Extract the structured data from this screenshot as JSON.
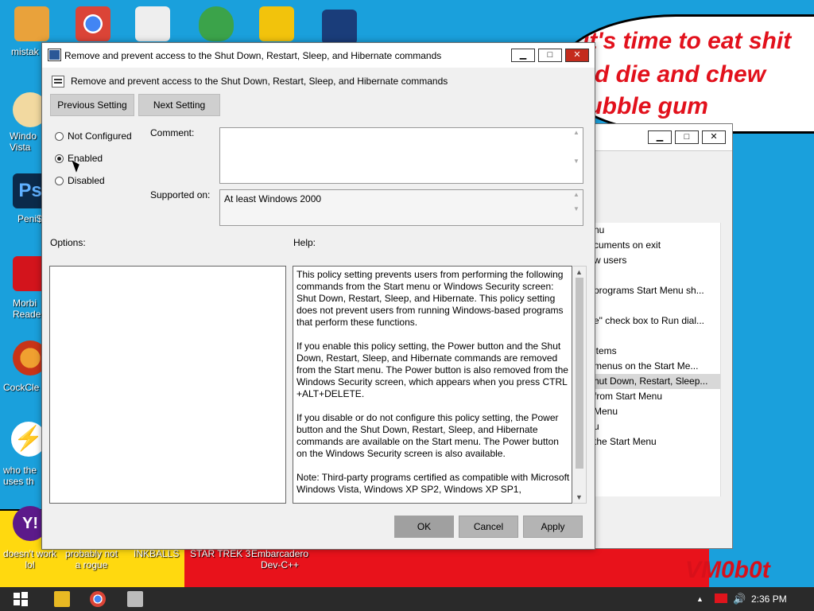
{
  "desktop": {
    "bubble_lines": [
      "it's time to eat shit",
      "and die and chew",
      "bubble gum"
    ],
    "signature": "VM0b0t",
    "icons_left": [
      "mistak",
      "Windo\nVista",
      "Peni$",
      "Morbi\nReade",
      "CockCle",
      "who the\nuses th",
      "doesn't work\nlol"
    ],
    "icons_bottom": [
      "probably not\na rogue",
      "INKBALLS",
      "STAR TREK 3",
      "Embarcadero\nDev-C++"
    ]
  },
  "back_window": {
    "items": [
      "nu",
      "cuments on exit",
      "w users",
      "",
      "programs Start Menu sh...",
      "",
      "e\" check box to Run dial...",
      "",
      "items",
      "menus on the Start Me...",
      "hut Down, Restart, Sleep...",
      "from Start Menu",
      "Menu",
      "u",
      "the Start Menu"
    ]
  },
  "dialog": {
    "title": "Remove and prevent access to the Shut Down, Restart, Sleep, and Hibernate commands",
    "header": "Remove and prevent access to the Shut Down, Restart, Sleep, and Hibernate commands",
    "prev_label": "Previous Setting",
    "next_label": "Next Setting",
    "radio_not_configured": "Not Configured",
    "radio_enabled": "Enabled",
    "radio_disabled": "Disabled",
    "selected": "Enabled",
    "comment_label": "Comment:",
    "supported_label": "Supported on:",
    "supported_value": "At least Windows 2000",
    "options_label": "Options:",
    "help_label": "Help:",
    "help_paragraphs": [
      "This policy setting prevents users from performing the following commands from the Start menu or Windows Security screen: Shut Down, Restart, Sleep, and Hibernate. This policy setting does not prevent users from running Windows-based programs that perform these functions.",
      "If you enable this policy setting, the Power button and the Shut Down, Restart, Sleep, and Hibernate commands are removed from the Start menu. The Power button is also removed from the Windows Security screen, which appears when you press CTRL +ALT+DELETE.",
      "If you disable or do not configure this policy setting, the Power button and the Shut Down, Restart, Sleep, and Hibernate commands are available on the Start menu. The Power button on the Windows Security screen is also available.",
      "Note: Third-party programs certified as compatible with Microsoft Windows Vista, Windows XP SP2, Windows XP SP1,"
    ],
    "ok_label": "OK",
    "cancel_label": "Cancel",
    "apply_label": "Apply"
  },
  "taskbar": {
    "time": "2:36 PM"
  },
  "colors": {
    "desktop": "#1aa0dc",
    "bubble_text": "#e2111c",
    "taskbar": "#2a2a2a"
  }
}
